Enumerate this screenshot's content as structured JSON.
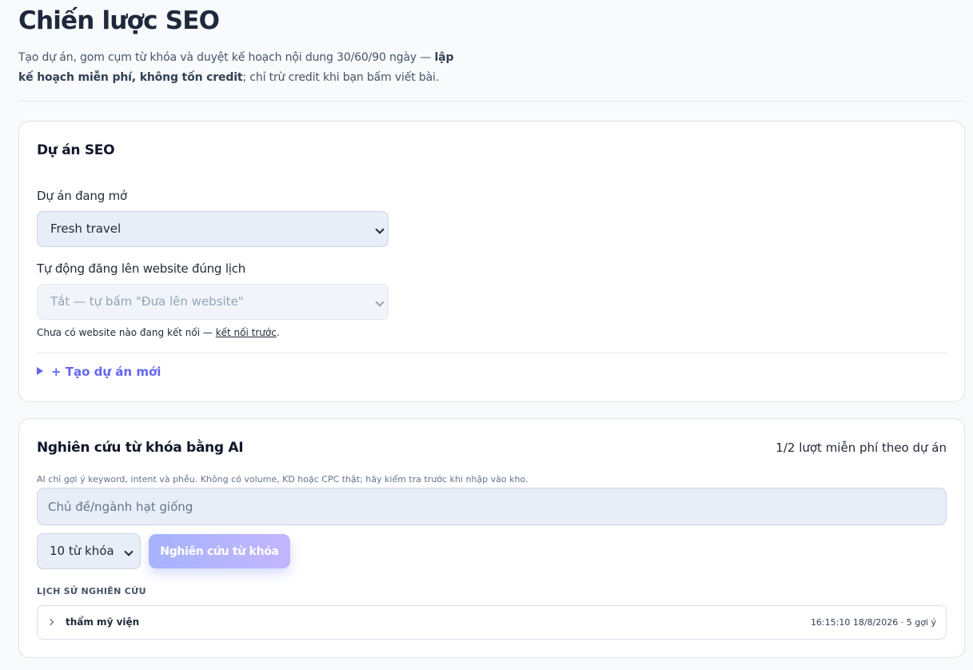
{
  "header": {
    "title": "Chiến lược SEO",
    "subtitle_plain1": "Tạo dự án, gom cụm từ khóa và duyệt kế hoạch nội dung 30/60/90 ngày — ",
    "subtitle_bold": "lập kế hoạch miễn phí, không tốn credit",
    "subtitle_plain2": "; chỉ trừ credit khi bạn bấm viết bài."
  },
  "project_card": {
    "title": "Dự án SEO",
    "open_project_label": "Dự án đang mở",
    "open_project_value": "Fresh travel",
    "autopost_label": "Tự động đăng lên website đúng lịch",
    "autopost_value": "Tắt — tự bấm \"Đưa lên website\"",
    "note_text": "Chưa có website nào đang kết nối — ",
    "note_link": "kết nối trước",
    "note_end": ".",
    "create_project": "+ Tạo dự án mới"
  },
  "research_card": {
    "title": "Nghiên cứu từ khóa bằng AI",
    "quota": "1/2 lượt miễn phí theo dự án",
    "hint": "AI chỉ gợi ý keyword, intent và phễu. Không có volume, KD hoặc CPC thật; hãy kiểm tra trước khi nhập vào kho.",
    "seed_placeholder": "Chủ đề/ngành hạt giống",
    "count_value": "10 từ khóa",
    "submit_label": "Nghiên cứu từ khóa",
    "history_title": "LỊCH SỬ NGHIÊN CỨU",
    "history": [
      {
        "topic": "thẩm mỹ viện",
        "meta": "16:15:10 18/8/2026 · 5 gợi ý"
      }
    ]
  },
  "colors": {
    "accent": "#6366f1",
    "button_gradient_start": "#a5b4fc",
    "button_gradient_end": "#c4b5fd",
    "input_bg": "#e8eef8"
  },
  "icons": {
    "select_arrow": "chevron-down-icon",
    "history_expand": "chevron-right-icon",
    "disclosure": "triangle-right-icon"
  }
}
